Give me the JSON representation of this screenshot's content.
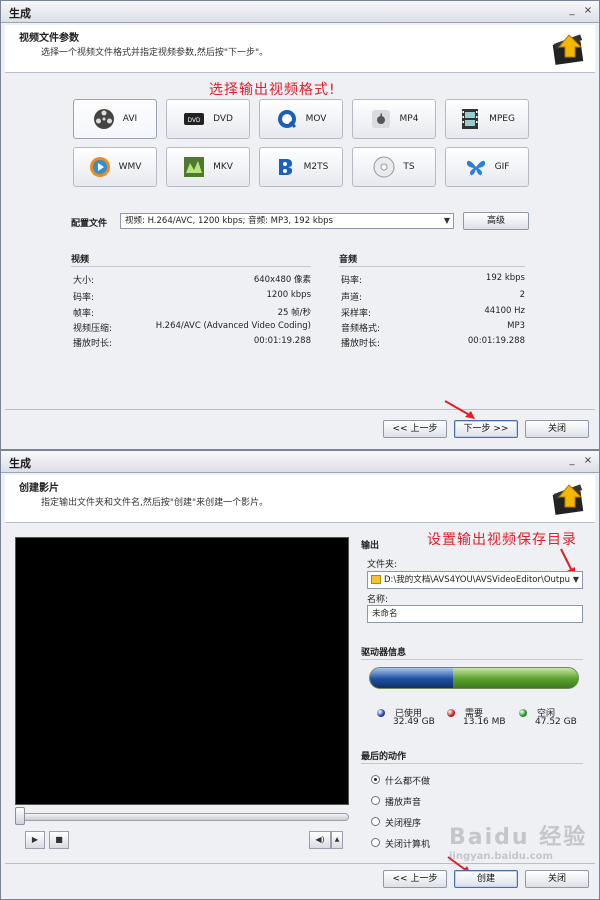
{
  "panel1": {
    "title": "生成",
    "minimize": "_",
    "close": "×",
    "header_title": "视频文件参数",
    "header_desc": "选择一个视频文件格式并指定视频参数,然后按\"下一步\"。",
    "annotation": "选择输出视频格式!",
    "formats": [
      {
        "label": "AVI",
        "icon": "film-reel-icon"
      },
      {
        "label": "DVD",
        "icon": "dvd-icon"
      },
      {
        "label": "MOV",
        "icon": "quicktime-icon"
      },
      {
        "label": "MP4",
        "icon": "apple-icon"
      },
      {
        "label": "MPEG",
        "icon": "filmstrip-icon"
      },
      {
        "label": "WMV",
        "icon": "windows-media-icon"
      },
      {
        "label": "MKV",
        "icon": "mkv-icon"
      },
      {
        "label": "M2TS",
        "icon": "bluray-icon"
      },
      {
        "label": "TS",
        "icon": "disc-icon"
      },
      {
        "label": "GIF",
        "icon": "butterfly-icon"
      }
    ],
    "profile_label": "配置文件",
    "profile_value": "视频: H.264/AVC, 1200 kbps; 音频: MP3, 192 kbps",
    "advanced_button": "高级",
    "video_heading": "视频",
    "audio_heading": "音频",
    "video_rows": [
      {
        "k": "大小:",
        "v": "640x480 像素"
      },
      {
        "k": "码率:",
        "v": "1200 kbps"
      },
      {
        "k": "帧率:",
        "v": "25 帧/秒"
      },
      {
        "k": "视频压缩:",
        "v": "H.264/AVC (Advanced Video Coding)"
      },
      {
        "k": "播放时长:",
        "v": "00:01:19.288"
      }
    ],
    "audio_rows": [
      {
        "k": "码率:",
        "v": "192 kbps"
      },
      {
        "k": "声道:",
        "v": "2"
      },
      {
        "k": "采样率:",
        "v": "44100 Hz"
      },
      {
        "k": "音频格式:",
        "v": "MP3"
      },
      {
        "k": "播放时长:",
        "v": "00:01:19.288"
      }
    ],
    "back_button": "<< 上一步",
    "next_button": "下一步 >>",
    "close_button": "关闭"
  },
  "panel2": {
    "title": "生成",
    "minimize": "_",
    "close": "×",
    "header_title": "创建影片",
    "header_desc": "指定输出文件夹和文件名,然后按\"创建\"来创建一个影片。",
    "annotation": "设置输出视频保存目录",
    "output_heading": "输出",
    "folder_label": "文件夹:",
    "folder_value": "D:\\我的文档\\AVS4YOU\\AVSVideoEditor\\Outpu",
    "name_label": "名称:",
    "name_value": "未命名",
    "drive_heading": "驱动器信息",
    "drive_used_fraction": 0.4,
    "legend": [
      {
        "label": "已使用",
        "value": "32.49 GB",
        "color": "#1d3f9a"
      },
      {
        "label": "需要",
        "value": "13.16 MB",
        "color": "#c0141c"
      },
      {
        "label": "空闲",
        "value": "47.52 GB",
        "color": "#1e8a2a"
      }
    ],
    "last_action_heading": "最后的动作",
    "actions": [
      "什么都不做",
      "播放声音",
      "关闭程序",
      "关闭计算机"
    ],
    "selected_action": 0,
    "back_button": "<< 上一步",
    "create_button": "创建",
    "close_button": "关闭",
    "watermark": "Baidu 经验",
    "watermark_sub": "jingyan.baidu.com"
  }
}
